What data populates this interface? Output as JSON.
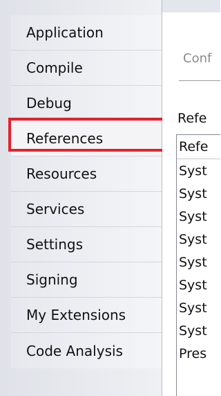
{
  "nav": {
    "items": [
      {
        "label": "Application",
        "name": "nav-item-application"
      },
      {
        "label": "Compile",
        "name": "nav-item-compile"
      },
      {
        "label": "Debug",
        "name": "nav-item-debug"
      },
      {
        "label": "References",
        "name": "nav-item-references"
      },
      {
        "label": "Resources",
        "name": "nav-item-resources"
      },
      {
        "label": "Services",
        "name": "nav-item-services"
      },
      {
        "label": "Settings",
        "name": "nav-item-settings"
      },
      {
        "label": "Signing",
        "name": "nav-item-signing"
      },
      {
        "label": "My Extensions",
        "name": "nav-item-my-extensions"
      },
      {
        "label": "Code Analysis",
        "name": "nav-item-code-analysis"
      }
    ],
    "selected_index": 3
  },
  "content": {
    "config_label": "Conf",
    "references_label": "Refe",
    "list_header": "Refe",
    "rows": [
      "Syst",
      "Syst",
      "Syst",
      "Syst",
      "Syst",
      "Syst",
      "Syst",
      "Syst",
      "Pres"
    ]
  },
  "colors": {
    "highlight": "#e8202a"
  }
}
